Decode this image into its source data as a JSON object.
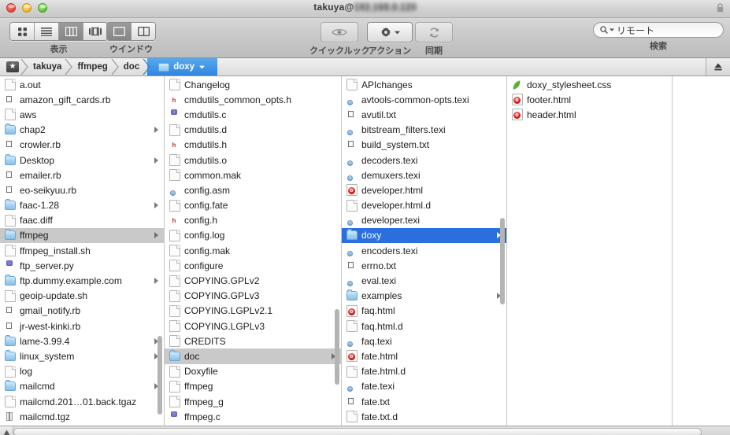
{
  "window": {
    "title_user": "takuya@",
    "title_host_redacted": "192.168.0.120",
    "lights": [
      "close",
      "minimize",
      "zoom"
    ]
  },
  "toolbar": {
    "view_group_label": "表示",
    "view_modes": [
      {
        "name": "icon-view",
        "active": false
      },
      {
        "name": "list-view",
        "active": false
      },
      {
        "name": "column-view",
        "active": true
      },
      {
        "name": "coverflow-view",
        "active": false
      }
    ],
    "window_group_label": "ウインドウ",
    "window_modes": [
      {
        "name": "single-pane",
        "active": true
      },
      {
        "name": "dual-pane",
        "active": false
      }
    ],
    "quicklook_label": "クイックルック",
    "action_label": "アクション",
    "sync_label": "同期",
    "search": {
      "value": "リモート",
      "label": "検索"
    }
  },
  "pathbar": {
    "crumbs": [
      {
        "label": "takuya",
        "active": false
      },
      {
        "label": "ffmpeg",
        "active": false
      },
      {
        "label": "doc",
        "active": false
      },
      {
        "label": "doxy",
        "active": true
      }
    ]
  },
  "columns": [
    {
      "name": "column-home",
      "items": [
        {
          "label": "a.out",
          "icon": "doc",
          "kind": "file"
        },
        {
          "label": "amazon_gift_cards.rb",
          "icon": "txt",
          "kind": "file"
        },
        {
          "label": "aws",
          "icon": "doc",
          "kind": "file"
        },
        {
          "label": "chap2",
          "icon": "folder",
          "kind": "folder"
        },
        {
          "label": "crowler.rb",
          "icon": "txt",
          "kind": "file"
        },
        {
          "label": "Desktop",
          "icon": "folder",
          "kind": "folder"
        },
        {
          "label": "emailer.rb",
          "icon": "txt",
          "kind": "file"
        },
        {
          "label": "eo-seikyuu.rb",
          "icon": "txt",
          "kind": "file"
        },
        {
          "label": "faac-1.28",
          "icon": "folder",
          "kind": "folder"
        },
        {
          "label": "faac.diff",
          "icon": "doc",
          "kind": "file"
        },
        {
          "label": "ffmpeg",
          "icon": "folder",
          "kind": "folder",
          "selected": "inactive"
        },
        {
          "label": "ffmpeg_install.sh",
          "icon": "doc",
          "kind": "file"
        },
        {
          "label": "ftp_server.py",
          "icon": "src",
          "kind": "file"
        },
        {
          "label": "ftp.dummy.example.com",
          "icon": "folder",
          "kind": "folder"
        },
        {
          "label": "geoip-update.sh",
          "icon": "doc",
          "kind": "file"
        },
        {
          "label": "gmail_notify.rb",
          "icon": "txt",
          "kind": "file"
        },
        {
          "label": "jr-west-kinki.rb",
          "icon": "txt",
          "kind": "file"
        },
        {
          "label": "lame-3.99.4",
          "icon": "folder",
          "kind": "folder"
        },
        {
          "label": "linux_system",
          "icon": "folder",
          "kind": "folder"
        },
        {
          "label": "log",
          "icon": "doc",
          "kind": "file"
        },
        {
          "label": "mailcmd",
          "icon": "folder",
          "kind": "folder"
        },
        {
          "label": "mailcmd.201…01.back.tgaz",
          "icon": "doc",
          "kind": "file"
        },
        {
          "label": "mailcmd.tgz",
          "icon": "archive",
          "kind": "file"
        }
      ]
    },
    {
      "name": "column-ffmpeg",
      "items": [
        {
          "label": "Changelog",
          "icon": "doc",
          "kind": "file"
        },
        {
          "label": "cmdutils_common_opts.h",
          "icon": "hdr",
          "kind": "file",
          "glyph": "h"
        },
        {
          "label": "cmdutils.c",
          "icon": "src",
          "kind": "file"
        },
        {
          "label": "cmdutils.d",
          "icon": "doc",
          "kind": "file"
        },
        {
          "label": "cmdutils.h",
          "icon": "hdr",
          "kind": "file",
          "glyph": "h"
        },
        {
          "label": "cmdutils.o",
          "icon": "doc",
          "kind": "file"
        },
        {
          "label": "common.mak",
          "icon": "doc",
          "kind": "file"
        },
        {
          "label": "config.asm",
          "icon": "texi",
          "kind": "file"
        },
        {
          "label": "config.fate",
          "icon": "doc",
          "kind": "file"
        },
        {
          "label": "config.h",
          "icon": "hdr",
          "kind": "file",
          "glyph": "h"
        },
        {
          "label": "config.log",
          "icon": "doc",
          "kind": "file"
        },
        {
          "label": "config.mak",
          "icon": "doc",
          "kind": "file"
        },
        {
          "label": "configure",
          "icon": "doc",
          "kind": "file"
        },
        {
          "label": "COPYING.GPLv2",
          "icon": "doc",
          "kind": "file"
        },
        {
          "label": "COPYING.GPLv3",
          "icon": "doc",
          "kind": "file"
        },
        {
          "label": "COPYING.LGPLv2.1",
          "icon": "doc",
          "kind": "file"
        },
        {
          "label": "COPYING.LGPLv3",
          "icon": "doc",
          "kind": "file"
        },
        {
          "label": "CREDITS",
          "icon": "doc",
          "kind": "file"
        },
        {
          "label": "doc",
          "icon": "folder",
          "kind": "folder",
          "selected": "inactive"
        },
        {
          "label": "Doxyfile",
          "icon": "doc",
          "kind": "file"
        },
        {
          "label": "ffmpeg",
          "icon": "doc",
          "kind": "file"
        },
        {
          "label": "ffmpeg_g",
          "icon": "doc",
          "kind": "file"
        },
        {
          "label": "ffmpeg.c",
          "icon": "src",
          "kind": "file"
        }
      ]
    },
    {
      "name": "column-doc",
      "items": [
        {
          "label": "APIchanges",
          "icon": "doc",
          "kind": "file"
        },
        {
          "label": "avtools-common-opts.texi",
          "icon": "texi",
          "kind": "file"
        },
        {
          "label": "avutil.txt",
          "icon": "txt",
          "kind": "file"
        },
        {
          "label": "bitstream_filters.texi",
          "icon": "texi",
          "kind": "file"
        },
        {
          "label": "build_system.txt",
          "icon": "txt",
          "kind": "file"
        },
        {
          "label": "decoders.texi",
          "icon": "texi",
          "kind": "file"
        },
        {
          "label": "demuxers.texi",
          "icon": "texi",
          "kind": "file"
        },
        {
          "label": "developer.html",
          "icon": "html",
          "kind": "file"
        },
        {
          "label": "developer.html.d",
          "icon": "doc",
          "kind": "file"
        },
        {
          "label": "developer.texi",
          "icon": "texi",
          "kind": "file"
        },
        {
          "label": "doxy",
          "icon": "folder",
          "kind": "folder",
          "selected": "active"
        },
        {
          "label": "encoders.texi",
          "icon": "texi",
          "kind": "file"
        },
        {
          "label": "errno.txt",
          "icon": "txt",
          "kind": "file"
        },
        {
          "label": "eval.texi",
          "icon": "texi",
          "kind": "file"
        },
        {
          "label": "examples",
          "icon": "folder",
          "kind": "folder"
        },
        {
          "label": "faq.html",
          "icon": "html",
          "kind": "file"
        },
        {
          "label": "faq.html.d",
          "icon": "doc",
          "kind": "file"
        },
        {
          "label": "faq.texi",
          "icon": "texi",
          "kind": "file"
        },
        {
          "label": "fate.html",
          "icon": "html",
          "kind": "file"
        },
        {
          "label": "fate.html.d",
          "icon": "doc",
          "kind": "file"
        },
        {
          "label": "fate.texi",
          "icon": "texi",
          "kind": "file"
        },
        {
          "label": "fate.txt",
          "icon": "txt",
          "kind": "file"
        },
        {
          "label": "fate.txt.d",
          "icon": "doc",
          "kind": "file"
        }
      ]
    },
    {
      "name": "column-doxy",
      "items": [
        {
          "label": "doxy_stylesheet.css",
          "icon": "css",
          "kind": "file"
        },
        {
          "label": "footer.html",
          "icon": "html",
          "kind": "file"
        },
        {
          "label": "header.html",
          "icon": "html",
          "kind": "file"
        }
      ]
    },
    {
      "name": "column-preview",
      "items": []
    }
  ],
  "colors": {
    "selection_active": "#2a6ee0",
    "selection_inactive": "#c9c9c9",
    "crumb_active": "#2e86e0",
    "window_chrome": "#c6c6c6"
  }
}
